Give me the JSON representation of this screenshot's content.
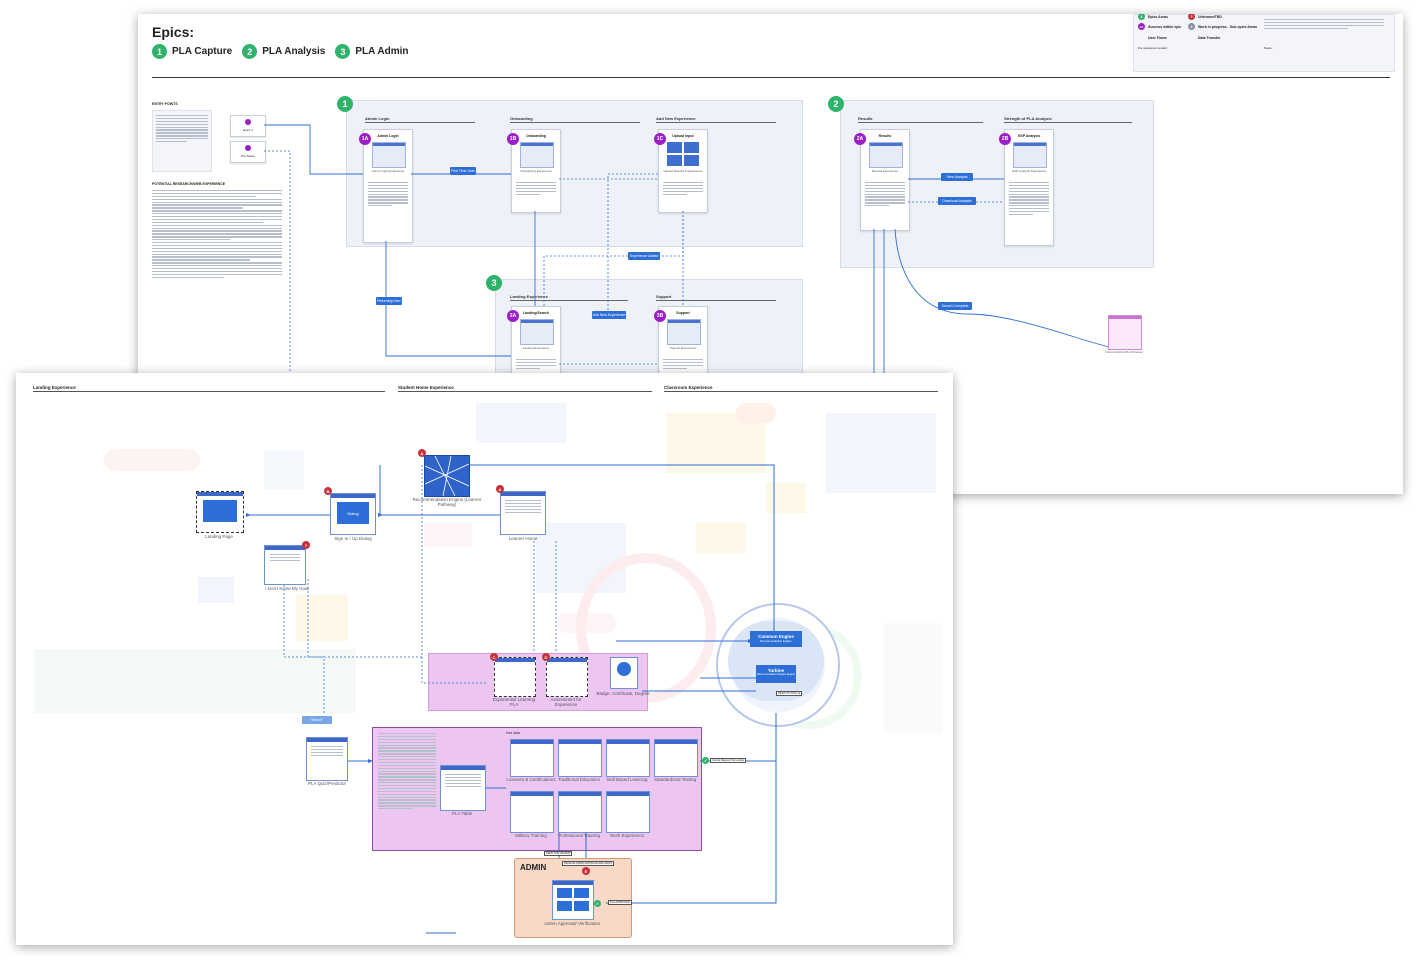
{
  "top_board": {
    "epics_title": "Epics:",
    "epics": [
      {
        "num": "1",
        "label": "PLA Capture"
      },
      {
        "num": "2",
        "label": "PLA Analysis"
      },
      {
        "num": "3",
        "label": "PLA Admin"
      }
    ],
    "legend": {
      "epic_areas": "Epics Areas",
      "success_within_epic": "Success within epic",
      "unknown_tbd": "Unknown/TBD",
      "work_in_progress": "Work in progress - Sub-epics Areas",
      "user_flows": "User Flows",
      "data_transfer": "Data Transfer",
      "badge_1a": "1A",
      "badge_q": "?",
      "badge_1": "1",
      "badge_2": "2",
      "for_questions": "For questions contact:",
      "notes": "Notes:"
    },
    "left_notes": {
      "entry_points": "ENTRY POINTS",
      "potential_research": "POTENTIAL RESEARCH/WEB EXPERIENCE"
    },
    "sections": {
      "admin_login": "Admin Login",
      "onboarding": "Onboarding",
      "add_new_experience": "Add New Experience",
      "results": "Results",
      "strength_of_pla": "Strength of PLA Analysis",
      "landing_experience": "Landing Experience",
      "support": "Support"
    },
    "badges": {
      "b1a": "1A",
      "b1b": "1B",
      "b1c": "1C",
      "b2a": "2A",
      "b2b": "2B",
      "b3a": "3A",
      "b3b": "3B",
      "e1": "1",
      "e2": "2",
      "e3": "3"
    },
    "cards": {
      "admin_login": "Admin Login",
      "onboarding": "Onboarding",
      "upload_input": "Upload Input",
      "results": "Results",
      "gap_analysis": "GSP Analysis",
      "landing_search": "Landing/Search",
      "support": "Support"
    },
    "card_captions": {
      "admin_login": "Admin Login Experience",
      "onboarding": "Onboarding Experience",
      "upload_input": "Upload Results & Experience",
      "results": "Results Experience",
      "gap_analysis": "GSP Analysis Experience",
      "landing_search": "Landing Experience",
      "support": "Support Experience"
    },
    "buttons": {
      "first_time_user": "First Time User",
      "returning_user": "Returning User",
      "experience_added": "Experience Added",
      "add_new_experience": "Add New Experience",
      "view_analysis": "View Analysis",
      "download_analysis": "Download Analysis",
      "search_complete": "Search Complete"
    },
    "side_boxes": {
      "box1": "Epics 1",
      "box2": "Pre-Setup"
    },
    "external_caption": "Current Admin PLA Process"
  },
  "bottom_board": {
    "section_titles": {
      "landing": "Landing Experience",
      "student_home": "Student Home Experience",
      "classroom": "Classroom Experience"
    },
    "nodes": {
      "landing_page": "Landing Page",
      "sign_in": "Sign In / Up Dialog",
      "dialog": "Dialog",
      "dont_know": "I Don't Know My Goal",
      "recommendation": "Recommendation Engine (Learner Pathway)",
      "learner_home": "Learner Home",
      "experiential": "Experiential Learning PLA",
      "assessment": "Assessment for Experience",
      "badge": "Badge, Certificate, Degree",
      "pla_quiz": "PLA Quiz/Predictor",
      "pla_table": "PLA Table",
      "licenses": "Licenses & Certifications",
      "traditional": "Traditional Education",
      "skills_based": "Skill Based Learning",
      "standardized": "Standardized Testing",
      "military": "Military Training",
      "professional": "Professional Training",
      "work_exp": "Work Experience",
      "admin_approval": "Admin Approval/ Verification"
    },
    "labels": {
      "select": "Select?",
      "has_data": "Has data",
      "admin": "ADMIN",
      "send_for_review": "SEND FOR REVIEW",
      "returned_from_admin": "RECEIVE ADMIN APPROVAL/DECISION",
      "approved": "PLA APPROVED",
      "course_map": "Course Mapped Via Lookup",
      "results_with": "RESULTS WITH AI"
    },
    "engine": {
      "common_engine": "Common Engine",
      "common_sub": "Recommendation Engine",
      "turbine": "Turbine",
      "turbine_sub": "Recommendation Engine Engine"
    },
    "badges": {
      "r1": "B",
      "r2": "C",
      "r3": "D",
      "r4": "E",
      "r5": "?",
      "r6": "A",
      "r7": "A"
    }
  },
  "colors": {
    "green": "#2fb36b",
    "purple": "#9b1fc9",
    "blue": "#2d6fd6",
    "pink_region": "#ecc6f0",
    "admin_region": "#f8d9c6"
  }
}
